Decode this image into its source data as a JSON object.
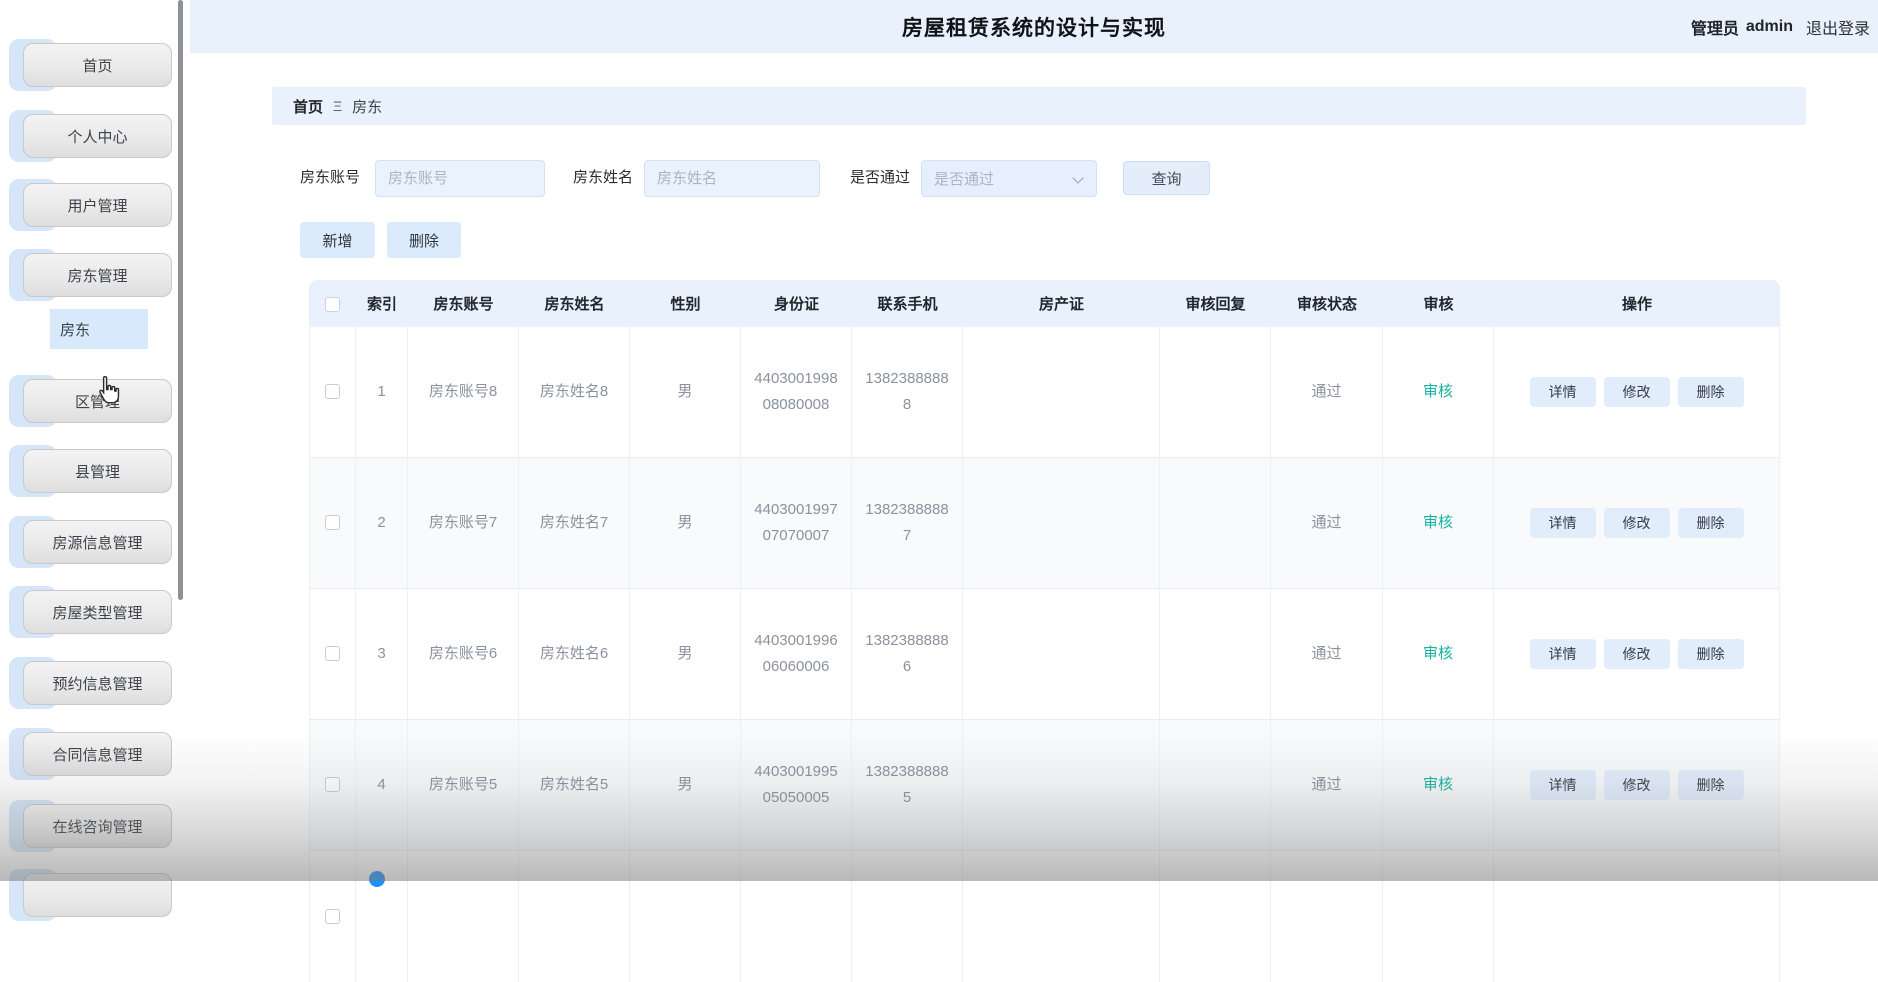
{
  "topbar": {
    "title": "房屋租赁系统的设计与实现",
    "user_role": "管理员",
    "username": "admin",
    "logout": "退出登录"
  },
  "sidebar": {
    "items": [
      "首页",
      "个人中心",
      "用户管理",
      "房东管理",
      "区管理",
      "县管理",
      "房源信息管理",
      "房屋类型管理",
      "预约信息管理",
      "合同信息管理",
      "在线咨询管理"
    ],
    "submenu_label": "房东"
  },
  "breadcrumb": {
    "home": "首页",
    "separator": "Ξ",
    "current": "房东"
  },
  "filters": {
    "account_label": "房东账号",
    "account_placeholder": "房东账号",
    "account_value": "",
    "name_label": "房东姓名",
    "name_placeholder": "房东姓名",
    "name_value": "",
    "pass_label": "是否通过",
    "pass_placeholder": "是否通过",
    "pass_value": "",
    "search_button": "查询"
  },
  "actions": {
    "add": "新增",
    "delete": "删除"
  },
  "table": {
    "columns": [
      "索引",
      "房东账号",
      "房东姓名",
      "性别",
      "身份证",
      "联系手机",
      "房产证",
      "审核回复",
      "审核状态",
      "审核",
      "操作"
    ],
    "review_label": "审核",
    "ops": {
      "detail": "详情",
      "edit": "修改",
      "del": "删除"
    },
    "rows": [
      {
        "index": "1",
        "account": "房东账号8",
        "name": "房东姓名8",
        "gender": "男",
        "id_card": "440300199808080008",
        "phone": "13823888888",
        "property_cert": "",
        "review_reply": "",
        "status": "通过"
      },
      {
        "index": "2",
        "account": "房东账号7",
        "name": "房东姓名7",
        "gender": "男",
        "id_card": "440300199707070007",
        "phone": "13823888887",
        "property_cert": "",
        "review_reply": "",
        "status": "通过"
      },
      {
        "index": "3",
        "account": "房东账号6",
        "name": "房东姓名6",
        "gender": "男",
        "id_card": "440300199606060006",
        "phone": "13823888886",
        "property_cert": "",
        "review_reply": "",
        "status": "通过"
      },
      {
        "index": "4",
        "account": "房东账号5",
        "name": "房东姓名5",
        "gender": "男",
        "id_card": "440300199505050005",
        "phone": "13823888885",
        "property_cert": "",
        "review_reply": "",
        "status": "通过"
      }
    ]
  },
  "colors": {
    "panel_blue": "#e9f2fc",
    "audit_link_teal": "#17b1a0",
    "loading_dot_blue": "#1e90ff"
  }
}
